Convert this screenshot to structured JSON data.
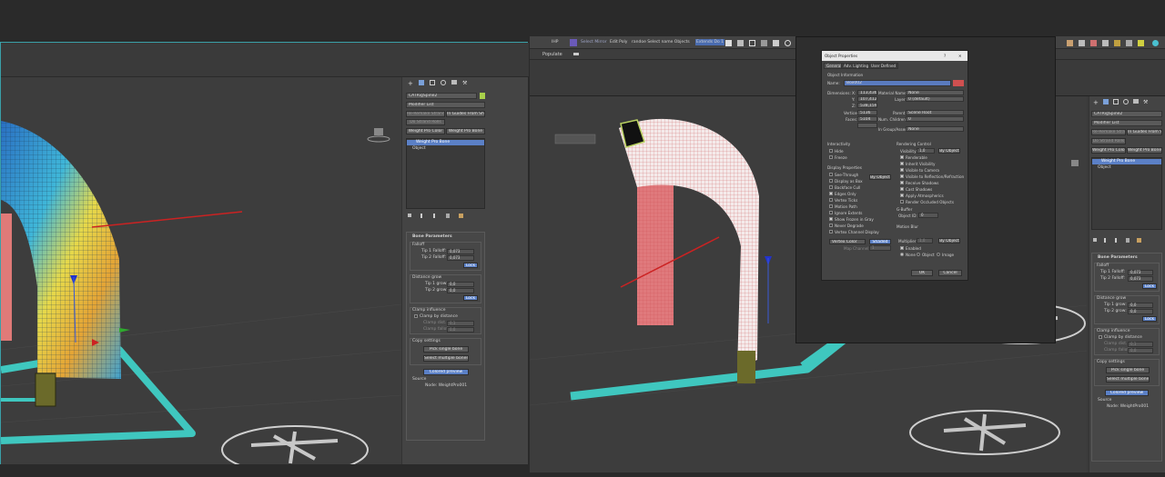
{
  "left": {
    "object_name": "CATRigSpine2",
    "modifier_list": "Modifier List",
    "btn_remake_strands": "Re-Remake Strands",
    "btn_guides_from_shape": "In Guides From Shape",
    "btn_ok_strand_rolls": "Do Strand Rolls",
    "btn_weight_pro_color": "Weight Pro Color",
    "btn_weight_pro_bone": "Weight Pro Bone",
    "stack": [
      "Weight Pro Bone",
      "Object"
    ],
    "rollout_title": "Bone Parameters",
    "falloff_label": "Falloff",
    "tip1_falloff_label": "Tip 1 Falloff:",
    "tip1_falloff_val": "0,073",
    "tip2_falloff_label": "Tip 2 Falloff:",
    "tip2_falloff_val": "0,073",
    "lock_label": "Lock",
    "distance_grow_label": "Distance grow",
    "tip1_grow_label": "Tip 1 grow:",
    "tip1_grow_val": "0,0",
    "tip2_grow_label": "Tip 2 grow:",
    "tip2_grow_val": "0,0",
    "lock2_label": "Lock",
    "clamp_label": "Clamp influence",
    "clamp_dist_label": "Clamp by distance",
    "clamp_dist_val_label": "Clamp dist.:",
    "clamp_dist_val": "0,1",
    "clamp_falloff_label": "Clamp falloff:",
    "clamp_falloff_val": "0,0",
    "copy_label": "Copy settings",
    "pick_single": "Pick single bone",
    "select_multiple": "Select multiple bones",
    "colored_preview": "Colored preview",
    "source_label": "Source",
    "node_label": "Node: WeightPro001"
  },
  "toolbar": {
    "items": [
      "IHP",
      "Select Mirror",
      "Edit Poly",
      "randoe Select name Objects",
      "Extends Do 1"
    ]
  },
  "populate_label": "Populate",
  "dialog": {
    "title": "Object Properties",
    "help": "?",
    "close": "✕",
    "tabs": [
      "General",
      "Adv. Lighting",
      "User Defined"
    ],
    "obj_info_label": "Object Information",
    "name_label": "Name:",
    "name_val": "Box002",
    "dimensions_label": "Dimensions:",
    "dim_x_label": "X:",
    "dim_x": "113,436m",
    "dim_y_label": "Y:",
    "dim_y": "107,412m",
    "dim_z_label": "Z:",
    "dim_z": "538,159m",
    "material_name_label": "Material Name:",
    "material_name": "None",
    "layer_label": "Layer:",
    "layer_val": "0 (default)",
    "vertices_label": "Vertices:",
    "vertices": "5136",
    "faces_label": "Faces:",
    "faces": "5104",
    "parent_label": "Parent:",
    "parent_val": "Scene Root",
    "children_label": "Num. Children:",
    "children_val": "0",
    "group_label": "In Group/Assembly:",
    "group_val": "None",
    "interactivity_label": "Interactivity",
    "hide_label": "Hide",
    "freeze_label": "Freeze",
    "display_props_label": "Display Properties",
    "display_items": [
      "See-Through",
      "Display as Box",
      "Backface Cull",
      "Edges Only",
      "Vertex Ticks",
      "Motion Path",
      "Ignore Extents",
      "Show Frozen in Gray",
      "Never Degrade",
      "Vertex Channel Display"
    ],
    "by_object": "By Object",
    "vertex_color_label": "Vertex Color",
    "shaded_label": "Shaded",
    "map_channel_label": "Map Channel:",
    "map_channel_val": "1",
    "rendering_label": "Rendering Control",
    "visibility_label": "Visibility:",
    "visibility_val": "1,0",
    "render_items": [
      "Renderable",
      "Inherit Visibility",
      "Visible to Camera",
      "Visible to Reflection/Refraction",
      "Receive Shadows",
      "Cast Shadows",
      "Apply Atmospherics",
      "Render Occluded Objects"
    ],
    "gbuffer_label": "G-Buffer",
    "object_id_label": "Object ID:",
    "object_id_val": "0",
    "motion_blur_label": "Motion Blur",
    "multiplier_label": "Multiplier:",
    "multiplier_val": "1,0",
    "enabled_label": "Enabled",
    "mb_none": "None",
    "mb_object": "Object",
    "mb_image": "Image",
    "ok_label": "OK",
    "cancel_label": "Cancel"
  },
  "right": {
    "object_name": "CATRigSpine2",
    "modifier_list": "Modifier List",
    "btn_remake_strands": "Re-Remake Strands",
    "btn_guides_from_shape": "In Guides From Shape",
    "btn_ok_strand_rolls": "Do Strand Rolls",
    "btn_weight_pro_color": "Weight Pro Color",
    "btn_weight_pro_bone": "Weight Pro Bone",
    "stack": [
      "Weight Pro Bone",
      "Object"
    ],
    "rollout_title": "Bone Parameters",
    "falloff_label": "Falloff",
    "tip1_falloff_label": "Tip 1 Falloff:",
    "tip1_falloff_val": "0,073",
    "tip2_falloff_label": "Tip 2 Falloff:",
    "tip2_falloff_val": "0,073",
    "lock_label": "Lock",
    "distance_grow_label": "Distance grow",
    "tip1_grow_label": "Tip 1 grow:",
    "tip1_grow_val": "0,0",
    "tip2_grow_label": "Tip 2 grow:",
    "tip2_grow_val": "0,0",
    "lock2_label": "Lock",
    "clamp_label": "Clamp influence",
    "clamp_dist_label": "Clamp by distance",
    "clamp_dist_val_label": "Clamp dist.:",
    "clamp_dist_val": "0,1",
    "clamp_falloff_label": "Clamp falloff:",
    "clamp_falloff_val": "0,0",
    "copy_label": "Copy settings",
    "pick_single": "Pick single bone",
    "select_multiple": "Select multiple bones",
    "colored_preview": "Colored preview",
    "source_label": "Source",
    "node_label": "Node: WeightPro001"
  }
}
